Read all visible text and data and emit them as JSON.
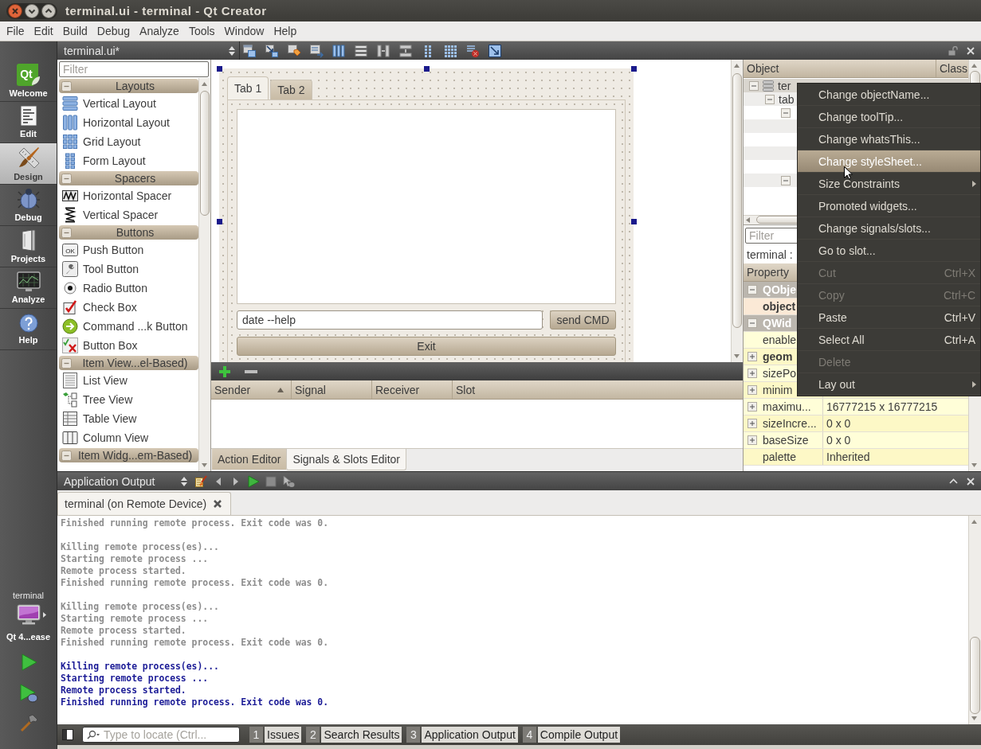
{
  "window": {
    "title": "terminal.ui - terminal - Qt Creator"
  },
  "menu_bar": {
    "items": [
      "File",
      "Edit",
      "Build",
      "Debug",
      "Analyze",
      "Tools",
      "Window",
      "Help"
    ]
  },
  "mode_bar": {
    "modes": [
      {
        "label": "Welcome",
        "logo_text": "Qt",
        "selected": false
      },
      {
        "label": "Edit",
        "selected": false
      },
      {
        "label": "Design",
        "selected": true
      },
      {
        "label": "Debug",
        "selected": false
      },
      {
        "label": "Projects",
        "selected": false
      },
      {
        "label": "Analyze",
        "selected": false
      },
      {
        "label": "Help",
        "selected": false
      }
    ],
    "project": "terminal",
    "target": "Qt 4...ease"
  },
  "editor_toolbar": {
    "document": "terminal.ui*"
  },
  "widget_box": {
    "filter": {
      "placeholder": "Filter"
    },
    "categories": [
      {
        "name": "Layouts",
        "expanded": true,
        "items": [
          {
            "label": "Vertical Layout"
          },
          {
            "label": "Horizontal Layout"
          },
          {
            "label": "Grid Layout"
          },
          {
            "label": "Form Layout"
          }
        ]
      },
      {
        "name": "Spacers",
        "expanded": true,
        "items": [
          {
            "label": "Horizontal Spacer"
          },
          {
            "label": "Vertical Spacer"
          }
        ]
      },
      {
        "name": "Buttons",
        "expanded": true,
        "items": [
          {
            "label": "Push Button",
            "icon_text": "OK"
          },
          {
            "label": "Tool Button"
          },
          {
            "label": "Radio Button"
          },
          {
            "label": "Check Box"
          },
          {
            "label": "Command ...k Button"
          },
          {
            "label": "Button Box"
          }
        ]
      },
      {
        "name": "Item View...el-Based)",
        "expanded": true,
        "items": [
          {
            "label": "List View"
          },
          {
            "label": "Tree View"
          },
          {
            "label": "Table View"
          },
          {
            "label": "Column View"
          }
        ]
      },
      {
        "name": "Item Widg...em-Based)",
        "expanded": true
      }
    ]
  },
  "form_editor": {
    "tabs": [
      {
        "label": "Tab 1",
        "selected": true
      },
      {
        "label": "Tab 2",
        "selected": false
      }
    ],
    "command_field": {
      "value": "date --help"
    },
    "send_button": "send CMD",
    "exit_button": "Exit"
  },
  "signals_slots": {
    "columns": [
      {
        "label": "Sender",
        "sorted": true
      },
      {
        "label": "Signal",
        "sorted": false
      },
      {
        "label": "Receiver",
        "sorted": false
      },
      {
        "label": "Slot",
        "sorted": false
      }
    ],
    "tabs": [
      {
        "label": "Action Editor",
        "selected": false
      },
      {
        "label": "Signals & Slots Editor",
        "selected": true
      }
    ]
  },
  "object_inspector": {
    "columns": [
      "Object",
      "Class"
    ],
    "tree": [
      {
        "name": "ter",
        "selected": true,
        "expanded": true,
        "children": [
          {
            "name": "tab",
            "selected": false,
            "expanded": true,
            "children": [
              {
                "selected": false,
                "expanded": true,
                "children": [
                  {
                    "selected": false
                  },
                  {
                    "selected": false
                  },
                  {
                    "selected": false
                  },
                  {
                    "selected": false
                  }
                ]
              },
              {
                "selected": false,
                "expanded": true
              }
            ]
          }
        ]
      }
    ]
  },
  "property_editor": {
    "filter": {
      "placeholder": "Filter"
    },
    "object_label": "terminal :",
    "header": "Property",
    "groups": [
      {
        "name": "QObje",
        "expanded": true,
        "properties": [
          {
            "name": "object",
            "changed": true
          }
        ]
      },
      {
        "name": "QWid",
        "expanded": true,
        "properties": [
          {
            "name": "enable",
            "changed": false
          },
          {
            "name": "geom",
            "changed": true,
            "expanded": false
          },
          {
            "name": "sizePo",
            "changed": false,
            "expanded": false
          },
          {
            "name": "minim",
            "changed": false,
            "expanded": false
          },
          {
            "name": "maximu...",
            "changed": false,
            "expanded": false,
            "value": "16777215 x 16777215"
          },
          {
            "name": "sizeIncre...",
            "changed": false,
            "expanded": false,
            "value": "0 x 0"
          },
          {
            "name": "baseSize",
            "changed": false,
            "expanded": false,
            "value": "0 x 0"
          },
          {
            "name": "palette",
            "changed": false,
            "value": "Inherited"
          }
        ]
      }
    ]
  },
  "context_menu": {
    "items": [
      {
        "label": "Change objectName...",
        "selected": false,
        "disabled": false,
        "submenu": false
      },
      {
        "label": "Change toolTip...",
        "selected": false,
        "disabled": false,
        "submenu": false
      },
      {
        "label": "Change whatsThis...",
        "selected": false,
        "disabled": false,
        "submenu": false
      },
      {
        "label": "Change styleSheet...",
        "selected": true,
        "disabled": false,
        "submenu": false
      },
      {
        "label": "Size Constraints",
        "selected": false,
        "disabled": false,
        "submenu": true
      },
      {
        "label": "Promoted widgets...",
        "selected": false,
        "disabled": false,
        "submenu": false
      },
      {
        "label": "Change signals/slots...",
        "selected": false,
        "disabled": false,
        "submenu": false
      },
      {
        "label": "Go to slot...",
        "selected": false,
        "disabled": false,
        "submenu": false
      },
      {
        "label": "Cut",
        "shortcut": "Ctrl+X",
        "selected": false,
        "disabled": true,
        "submenu": false
      },
      {
        "label": "Copy",
        "shortcut": "Ctrl+C",
        "selected": false,
        "disabled": true,
        "submenu": false
      },
      {
        "label": "Paste",
        "shortcut": "Ctrl+V",
        "selected": false,
        "disabled": false,
        "submenu": false
      },
      {
        "label": "Select All",
        "shortcut": "Ctrl+A",
        "selected": false,
        "disabled": false,
        "submenu": false
      },
      {
        "label": "Delete",
        "selected": false,
        "disabled": true,
        "submenu": false
      },
      {
        "label": "Lay out",
        "selected": false,
        "disabled": false,
        "submenu": true
      }
    ]
  },
  "output_pane": {
    "selector": "Application Output",
    "tab": {
      "label": "terminal (on Remote Device)"
    },
    "blocks": [
      {
        "stale": true,
        "lines": [
          "Finished running remote process. Exit code was 0."
        ]
      },
      {
        "stale": true,
        "lines": [
          "Killing remote process(es)...",
          "Starting remote process ...",
          "Remote process started.",
          "Finished running remote process. Exit code was 0."
        ]
      },
      {
        "stale": true,
        "lines": [
          "Killing remote process(es)...",
          "Starting remote process ...",
          "Remote process started.",
          "Finished running remote process. Exit code was 0."
        ]
      },
      {
        "stale": false,
        "lines": [
          "Killing remote process(es)...",
          "Starting remote process ...",
          "Remote process started.",
          "Finished running remote process. Exit code was 0."
        ]
      }
    ]
  },
  "status_bar": {
    "locator": {
      "placeholder": "Type to locate (Ctrl..."
    },
    "panes": [
      {
        "number": "1",
        "label": "Issues"
      },
      {
        "number": "2",
        "label": "Search Results"
      },
      {
        "number": "3",
        "label": "Application Output"
      },
      {
        "number": "4",
        "label": "Compile Output"
      }
    ]
  }
}
